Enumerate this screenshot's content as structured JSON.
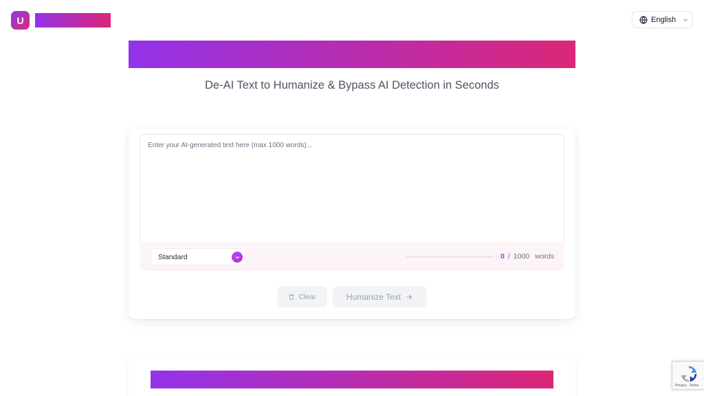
{
  "header": {
    "logo_letter": "U",
    "language": {
      "label": "English",
      "icon": "globe-icon",
      "chevron": "chevron-down-icon"
    }
  },
  "hero": {
    "subtitle": "De-AI Text to Humanize & Bypass AI Detection in Seconds"
  },
  "editor": {
    "placeholder": "Enter your AI-generated text here (max 1000 words)...",
    "value": "",
    "mode": {
      "selected": "Standard",
      "icon": "chevron-down-icon"
    },
    "word_progress": 0,
    "counter": {
      "current": "0",
      "separator": "/",
      "max": "1000",
      "unit": "words"
    }
  },
  "actions": {
    "clear_label": "Clear",
    "clear_icon": "trash-icon",
    "humanize_label": "Humanize Text",
    "humanize_icon": "arrow-right-icon"
  },
  "recaptcha": {
    "links": "Privacy - Terms"
  },
  "colors": {
    "gradient_start": "#9333ea",
    "gradient_end": "#db2777",
    "accent": "#9333ea"
  }
}
